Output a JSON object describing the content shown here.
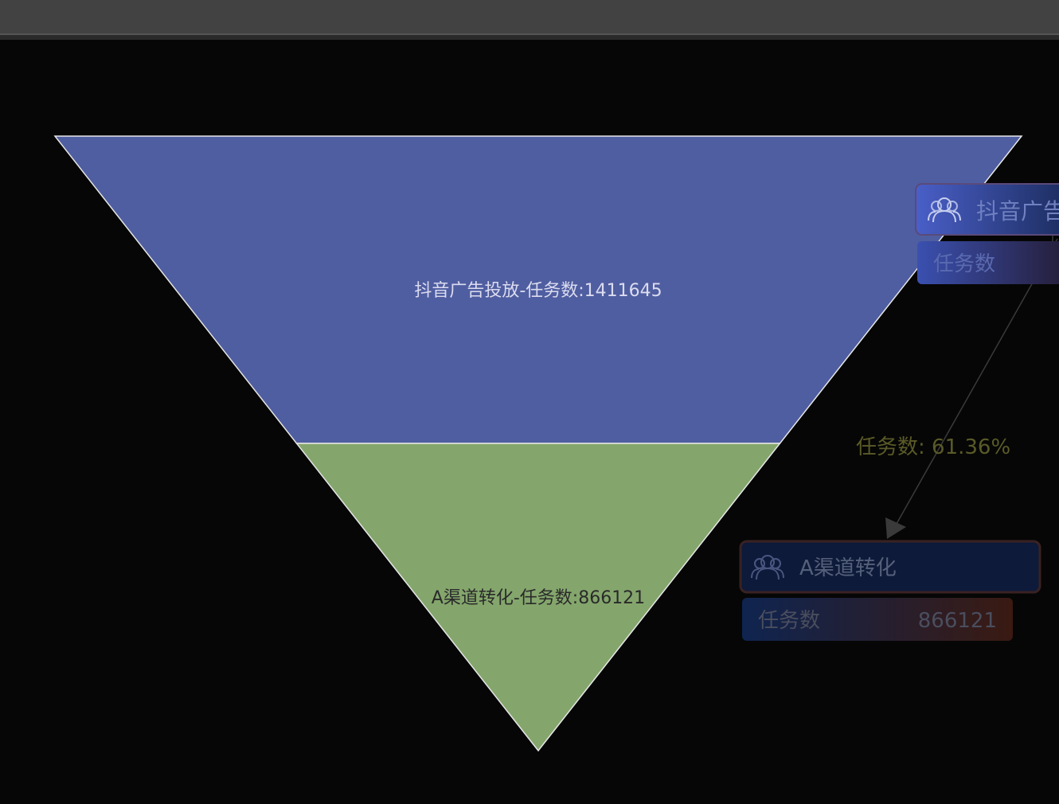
{
  "chart_data": {
    "type": "funnel",
    "stages": [
      {
        "name": "抖音广告投放",
        "metric": "任务数",
        "value": 1411645,
        "label": "抖音广告投放-任务数:1411645",
        "color": "#4f5ea0",
        "text_color": "#dcdcf0"
      },
      {
        "name": "A渠道转化",
        "metric": "任务数",
        "value": 866121,
        "label": "A渠道转化-任务数:866121",
        "color": "#84a66c",
        "text_color": "#2a2a2a"
      }
    ],
    "conversion": {
      "label": "任务数: 61.36%",
      "value": 61.36
    }
  },
  "cards": [
    {
      "title": "抖音广告",
      "metric_label": "任务数",
      "metric_value": "",
      "icon": "users-icon"
    },
    {
      "title": "A渠道转化",
      "metric_label": "任务数",
      "metric_value": "866121",
      "icon": "users-icon"
    }
  ],
  "colors": {
    "background": "#060606",
    "topbar": "#424242",
    "card_bg": "#0d1a3a",
    "card_border": "#3a2222",
    "conversion_text": "#5a5a28"
  }
}
